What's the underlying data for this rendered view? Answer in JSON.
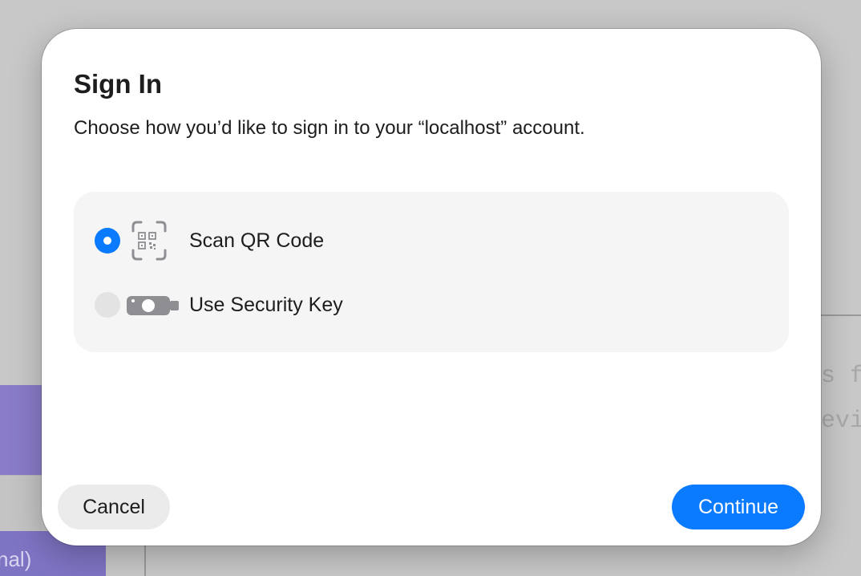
{
  "background": {
    "purple_field_text": "nal)",
    "code_line_1": "s f",
    "code_line_2": "evi"
  },
  "dialog": {
    "title": "Sign In",
    "subtitle": "Choose how you’d like to sign in to your “localhost” account.",
    "options": [
      {
        "label": "Scan QR Code",
        "icon": "qr-code-icon",
        "selected": true
      },
      {
        "label": "Use Security Key",
        "icon": "security-key-icon",
        "selected": false
      }
    ],
    "cancel_label": "Cancel",
    "continue_label": "Continue"
  },
  "colors": {
    "accent": "#0a7aff",
    "options_background": "#f5f5f5",
    "cancel_background": "#ebebeb"
  }
}
